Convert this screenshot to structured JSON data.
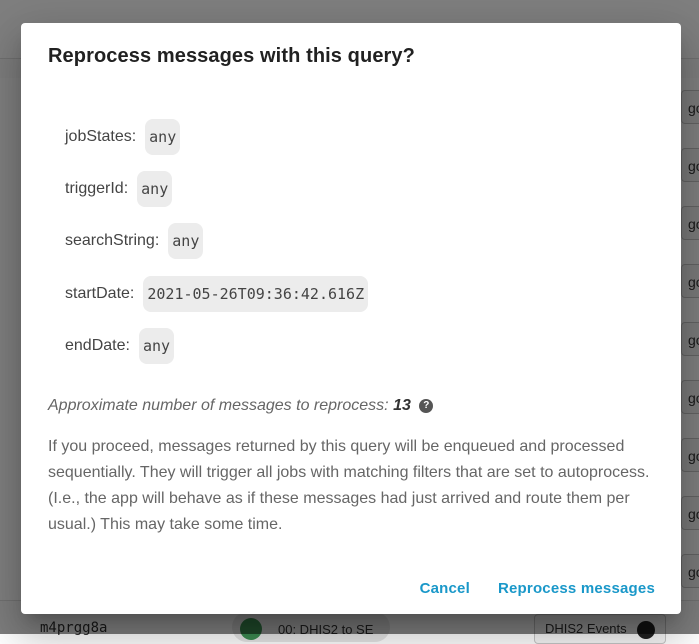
{
  "background": {
    "row_action_label": "go",
    "bottom_row": {
      "message_id": "m4prgg8a",
      "flow_label": "00: DHIS2 to SE",
      "events_label": "DHIS2 Events"
    }
  },
  "dialog": {
    "title": "Reprocess messages with this query?",
    "params": [
      {
        "label": "jobStates:",
        "value": "any"
      },
      {
        "label": "triggerId:",
        "value": "any"
      },
      {
        "label": "searchString:",
        "value": "any"
      },
      {
        "label": "startDate:",
        "value": "2021-05-26T09:36:42.616Z"
      },
      {
        "label": "endDate:",
        "value": "any"
      }
    ],
    "approx_label": "Approximate number of messages to reprocess:",
    "approx_count": "13",
    "help_glyph": "?",
    "body": "If you proceed, messages returned by this query will be enqueued and processed sequentially. They will trigger all jobs with matching filters that are set to autoprocess. (I.e., the app will behave as if these messages had just arrived and route them per usual.) This may take some time.",
    "cancel_label": "Cancel",
    "confirm_label": "Reprocess messages"
  },
  "colors": {
    "primary": "#1a98c9",
    "scrim": "rgba(0,0,0,0.5)"
  }
}
